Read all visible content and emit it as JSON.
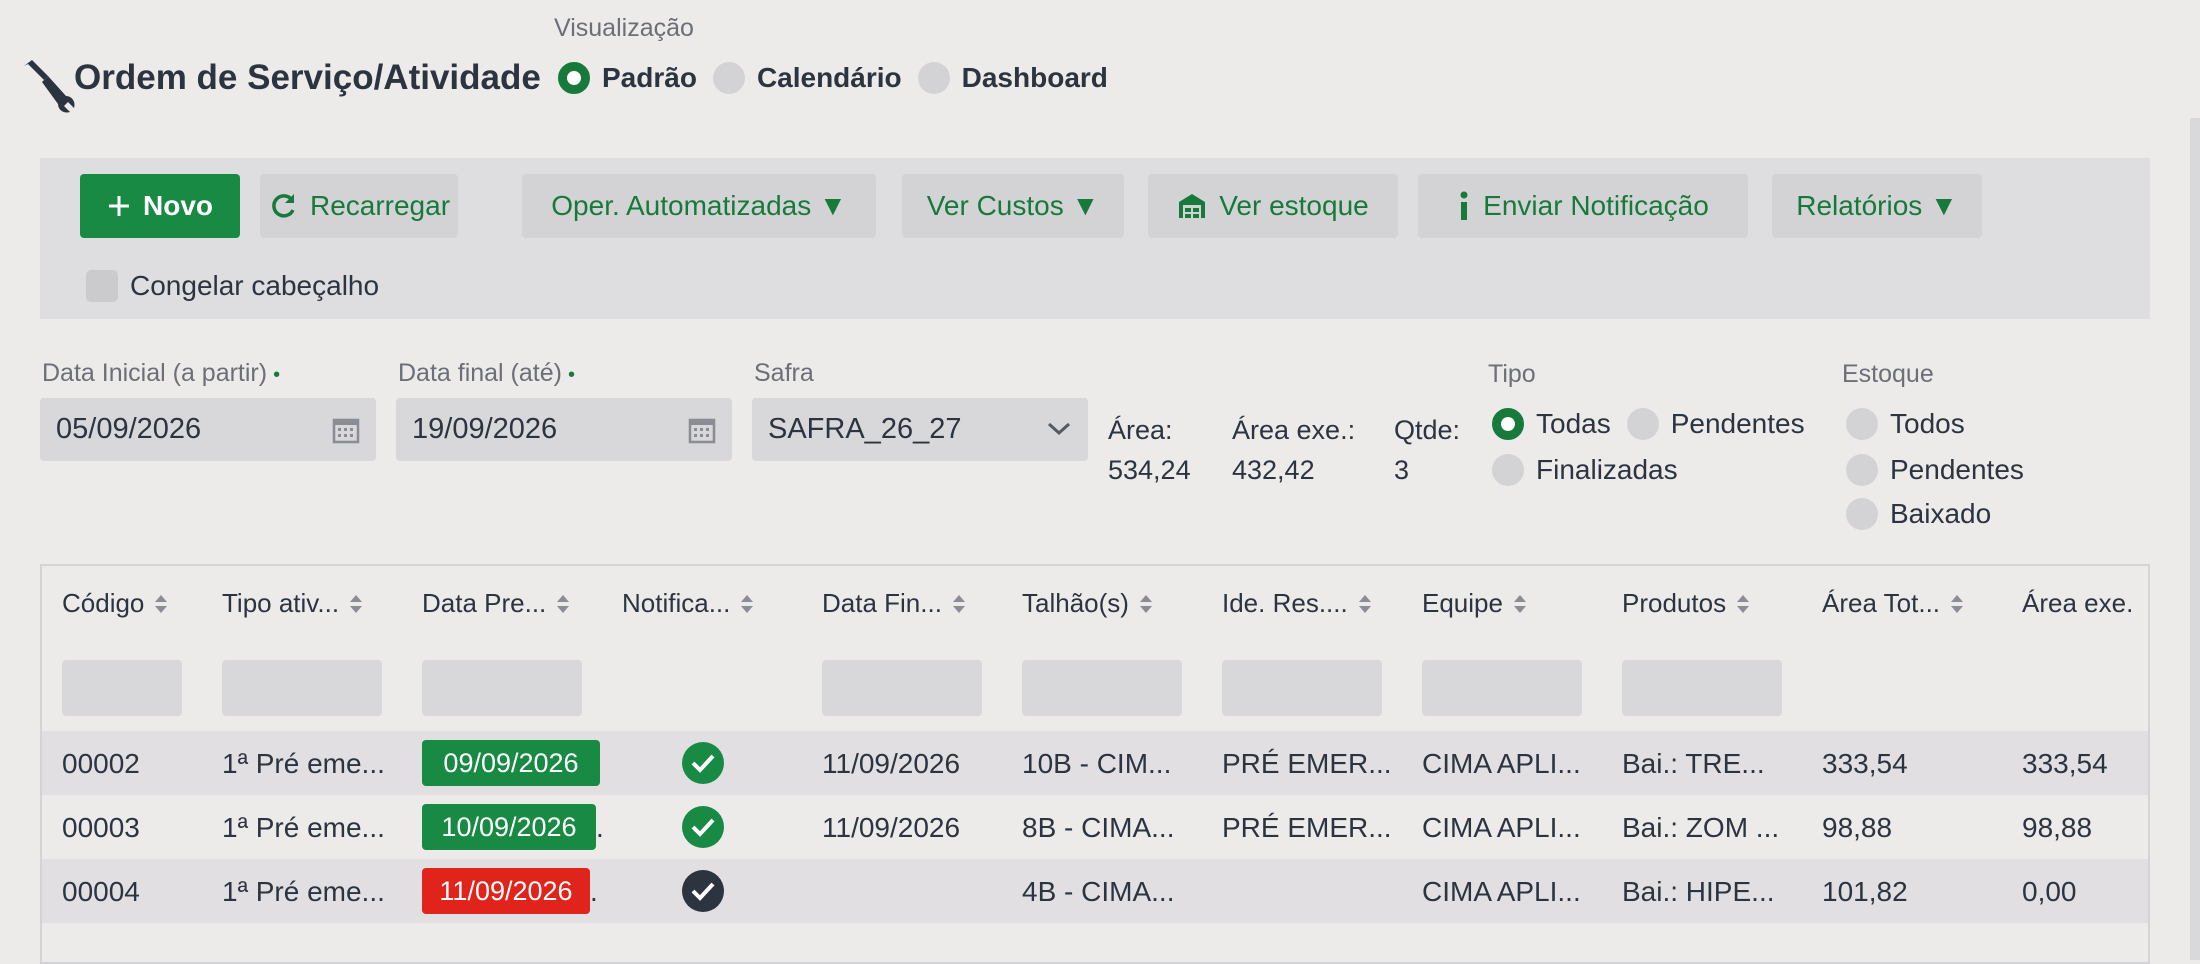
{
  "header": {
    "title": "Ordem de Serviço/Atividade",
    "visualization_label": "Visualização",
    "views": [
      {
        "label": "Padrão",
        "selected": true
      },
      {
        "label": "Calendário",
        "selected": false
      },
      {
        "label": "Dashboard",
        "selected": false
      }
    ]
  },
  "toolbar": {
    "new_label": "Novo",
    "reload_label": "Recarregar",
    "auto_ops_label": "Oper. Automatizadas ▼",
    "costs_label": "Ver Custos ▼",
    "stock_label": "Ver estoque",
    "notify_label": "Enviar Notificação",
    "reports_label": "Relatórios ▼",
    "freeze_label": "Congelar cabeçalho"
  },
  "filters": {
    "start_label": "Data Inicial (a partir)",
    "start_value": "05/09/2026",
    "end_label": "Data final (até)",
    "end_value": "19/09/2026",
    "required_mark": "•",
    "safra_label": "Safra",
    "safra_value": "SAFRA_26_27",
    "area_label": "Área:",
    "area_value": "534,24",
    "area_exe_label": "Área exe.:",
    "area_exe_value": "432,42",
    "qtde_label": "Qtde:",
    "qtde_value": "3",
    "tipo_label": "Tipo",
    "tipo_options": [
      {
        "label": "Todas",
        "selected": true
      },
      {
        "label": "Pendentes",
        "selected": false
      },
      {
        "label": "Finalizadas",
        "selected": false
      }
    ],
    "estoque_label": "Estoque",
    "estoque_options": [
      {
        "label": "Todos",
        "selected": false
      },
      {
        "label": "Pendentes",
        "selected": false
      },
      {
        "label": "Baixado",
        "selected": false
      }
    ]
  },
  "table": {
    "columns": [
      "Código",
      "Tipo ativ...",
      "Data Pre...",
      "Notifica...",
      "Data Fin...",
      "Talhão(s)",
      "Ide. Res....",
      "Equipe",
      "Produtos",
      "Área Tot...",
      "Área exe."
    ],
    "rows": [
      {
        "codigo": "00002",
        "tipo": "1ª Pré eme...",
        "data_pre": "09/09/2026",
        "data_pre_status": "green",
        "notified": "green",
        "data_fin": "11/09/2026",
        "talhao": "10B - CIM...",
        "ide": "PRÉ EMER...",
        "equipe": "CIMA APLI...",
        "produtos": "Bai.: TRE...",
        "area_tot": "333,54",
        "area_exe": "333,54"
      },
      {
        "codigo": "00003",
        "tipo": "1ª Pré eme...",
        "data_pre": "10/09/2026",
        "data_pre_status": "green",
        "notified": "green",
        "data_fin": "11/09/2026",
        "talhao": "8B - CIMA...",
        "ide": "PRÉ EMER...",
        "equipe": "CIMA APLI...",
        "produtos": "Bai.: ZOM ...",
        "area_tot": "98,88",
        "area_exe": "98,88"
      },
      {
        "codigo": "00004",
        "tipo": "1ª Pré eme...",
        "data_pre": "11/09/2026",
        "data_pre_status": "red",
        "notified": "dark",
        "data_fin": "",
        "talhao": "4B - CIMA...",
        "ide": "",
        "equipe": "CIMA APLI...",
        "produtos": "Bai.: HIPE...",
        "area_tot": "101,82",
        "area_exe": "0,00"
      }
    ]
  },
  "colors": {
    "accent_green": "#177a3a",
    "badge_green": "#188a44",
    "badge_red": "#e0231b",
    "check_dark": "#2c3440"
  }
}
